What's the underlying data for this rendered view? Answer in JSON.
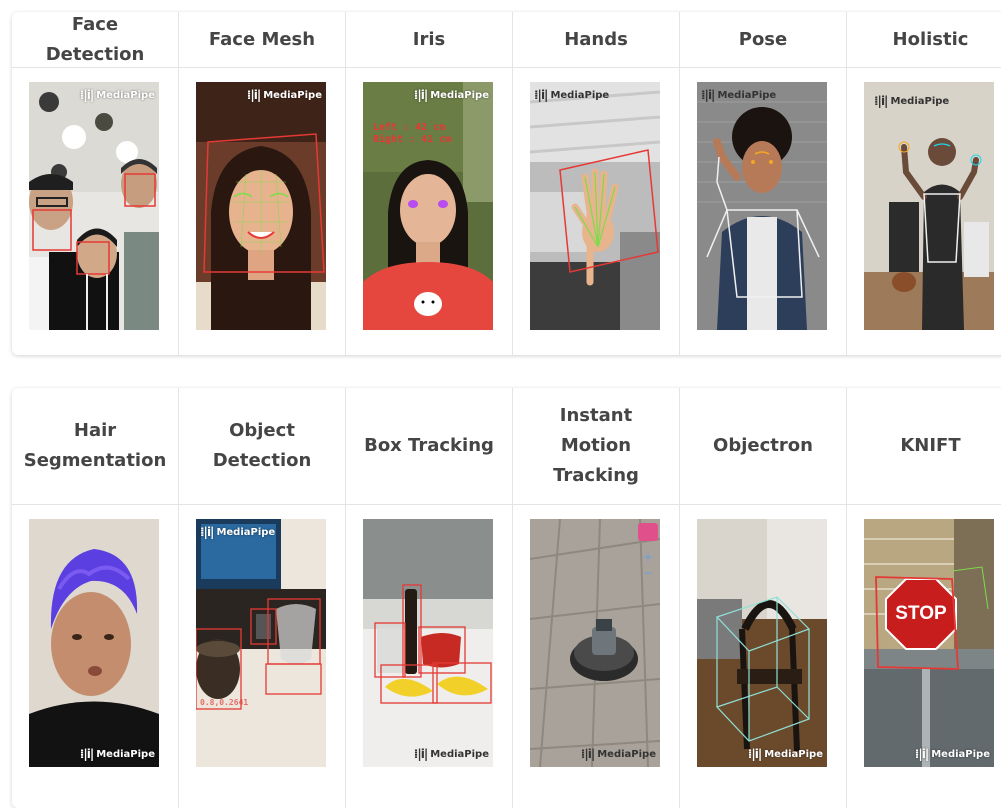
{
  "solutions_row1": [
    {
      "name": "Face Detection"
    },
    {
      "name": "Face Mesh"
    },
    {
      "name": "Iris"
    },
    {
      "name": "Hands"
    },
    {
      "name": "Pose"
    },
    {
      "name": "Holistic"
    }
  ],
  "solutions_row2": [
    {
      "name": "Hair Segmentation"
    },
    {
      "name": "Object Detection"
    },
    {
      "name": "Box Tracking"
    },
    {
      "name": "Instant Motion Tracking"
    },
    {
      "name": "Objectron"
    },
    {
      "name": "KNIFT"
    }
  ],
  "logo": {
    "mark": "⁞|i|",
    "text": "MediaPipe"
  },
  "iris_overlay": {
    "line1": "Left : 42 cm",
    "line2": "Right : 41 cm"
  },
  "knift_sign": "STOP",
  "colors": {
    "accent_red": "#e53935",
    "landmark_green": "#7ddc4a",
    "pose_white": "#f0f0f0",
    "border": "#e4e4e4",
    "header_text": "#454545"
  }
}
